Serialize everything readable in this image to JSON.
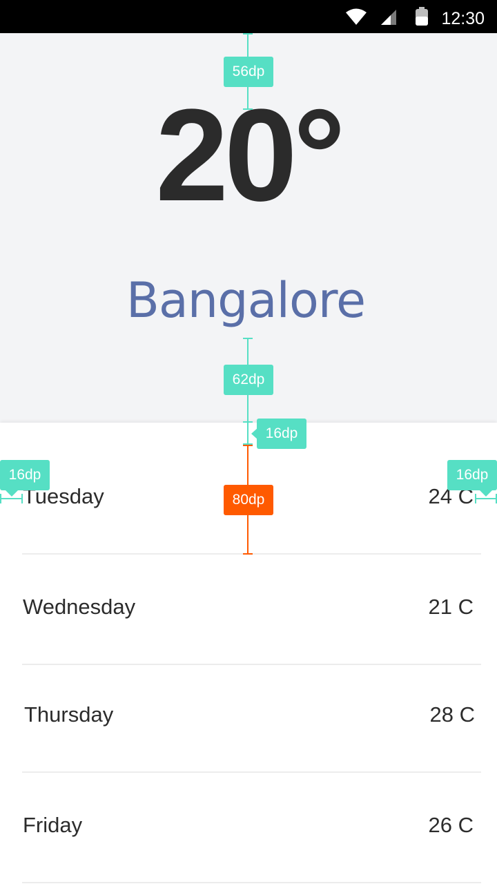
{
  "status_bar": {
    "time": "12:30",
    "icons": [
      "wifi-icon",
      "cell-signal-icon",
      "battery-icon"
    ]
  },
  "weather": {
    "temperature": "20°",
    "city": "Bangalore"
  },
  "forecast": [
    {
      "day": "Tuesday",
      "temp": "24 C"
    },
    {
      "day": "Wednesday",
      "temp": "21 C"
    },
    {
      "day": "Thursday",
      "temp": "28 C"
    },
    {
      "day": "Friday",
      "temp": "26 C"
    }
  ],
  "spec_annotations": {
    "top_padding": "56dp",
    "bottom_padding": "62dp",
    "list_top_padding": "16dp",
    "left_padding": "16dp",
    "right_padding": "16dp",
    "row_height": "80dp"
  },
  "colors": {
    "header_bg": "#f3f4f6",
    "temperature": "#2b2b2b",
    "city": "#5a6fa8",
    "spec_teal": "#56dfc4",
    "spec_orange": "#ff5a00"
  }
}
